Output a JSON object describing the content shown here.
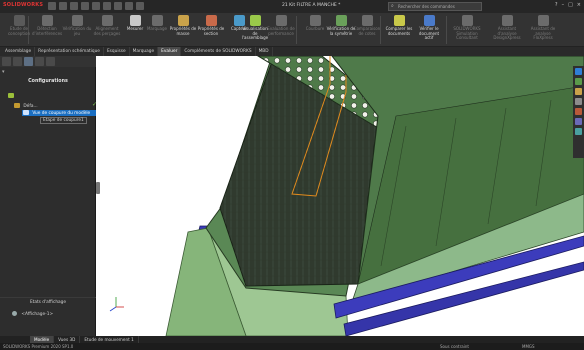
{
  "app": {
    "logo": "SOLIDWORKS",
    "document_title": "21 Kit FILTRE A MANCHE *"
  },
  "search": {
    "placeholder": "Rechercher des commandes"
  },
  "ribbon": {
    "items": [
      {
        "label": "Etude de conception",
        "enabled": false
      },
      {
        "label": "Détection d'interférences",
        "enabled": false
      },
      {
        "label": "Vérification du jeu",
        "enabled": false
      },
      {
        "label": "Alignement des perçages",
        "enabled": false
      },
      {
        "label": "Mesurer",
        "enabled": true
      },
      {
        "label": "Marquage",
        "enabled": false
      },
      {
        "label": "Propriétés de masse",
        "enabled": true
      },
      {
        "label": "Propriétés de section",
        "enabled": true
      },
      {
        "label": "Capteur",
        "enabled": true
      },
      {
        "label": "Visualisation de l'assemblage",
        "enabled": true
      },
      {
        "label": "Evaluation de performance",
        "enabled": false
      },
      {
        "label": "Courbure",
        "enabled": false
      },
      {
        "label": "Vérification de la symétrie",
        "enabled": true
      },
      {
        "label": "Comparaison de cotes",
        "enabled": false
      },
      {
        "label": "",
        "enabled": false
      },
      {
        "label": "Comparer les documents",
        "enabled": true
      },
      {
        "label": "Vérifier le document actif",
        "enabled": true
      },
      {
        "label": "SOLIDWORKS Simulation Consultant",
        "enabled": false
      },
      {
        "label": "Assistant d'analyse DesignXpress",
        "enabled": false
      },
      {
        "label": "Assistant de analyse FloXpress",
        "enabled": false
      }
    ]
  },
  "command_tabs": [
    "Assemblage",
    "Représentation schématique",
    "Esquisse",
    "Marquage",
    "Evaluer",
    "Compléments de SOLIDWORKS",
    "MBD"
  ],
  "active_command_tab": "Evaluer",
  "left_panel": {
    "title": "Configurations",
    "tree": {
      "root": "",
      "default": "Défa...",
      "selected": "Vue de coupure du modèle",
      "step": "Etape de coupure1"
    },
    "display_states_title": "Etats d'affichage",
    "display_state": "<Affichage-1>"
  },
  "bottom_tabs": [
    "Modèle",
    "Vues 3D",
    "Etude de mouvement 1"
  ],
  "active_bottom_tab": "Modèle",
  "status": {
    "left": "SOLIDWORKS Premium 2020 SP1.0",
    "middle": "Sous contraint",
    "units": "MMGS"
  },
  "colors": {
    "accent_blue": "#1b6fc2",
    "model_green": "#4e7a4a",
    "frame_blue": "#3a3ab8",
    "background": "#2b2b2b"
  },
  "icons": [
    "search-icon",
    "home-icon",
    "save-icon",
    "print-icon",
    "undo-icon",
    "select-arrow-icon",
    "gear-icon",
    "help-icon"
  ]
}
